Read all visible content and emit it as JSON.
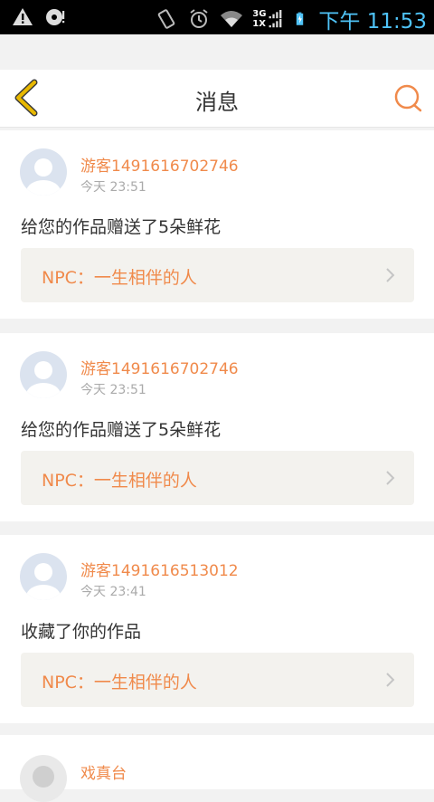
{
  "status_bar": {
    "time": "下午 11:53",
    "network_top": "3G",
    "network_bottom": "1X",
    "icons": [
      "warning-icon",
      "disc-icon",
      "vibrate-icon",
      "alarm-icon",
      "wifi-icon",
      "signal-icon",
      "battery-charging-icon"
    ]
  },
  "header": {
    "title": "消息",
    "back_icon": "chevron-left-icon",
    "search_icon": "search-icon"
  },
  "colors": {
    "accent": "#f08a4b",
    "back_arrow": "#e8b800",
    "clock": "#4fc3f7"
  },
  "messages": [
    {
      "username": "游客1491616702746",
      "time": "今天 23:51",
      "text": "给您的作品赠送了5朵鲜花",
      "work": "NPC：一生相伴的人"
    },
    {
      "username": "游客1491616702746",
      "time": "今天 23:51",
      "text": "给您的作品赠送了5朵鲜花",
      "work": "NPC：一生相伴的人"
    },
    {
      "username": "游客1491616513012",
      "time": "今天 23:41",
      "text": "收藏了你的作品",
      "work": "NPC：一生相伴的人"
    },
    {
      "username": "戏真台"
    }
  ]
}
